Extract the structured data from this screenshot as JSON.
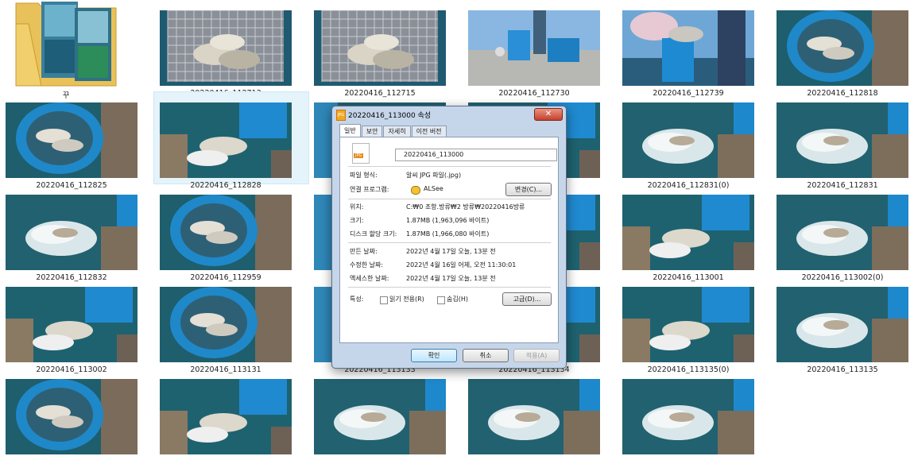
{
  "folder": {
    "label": "꾸"
  },
  "tiles": [
    {
      "id": "t01",
      "label": "20220416_112713",
      "col": 1,
      "row": 0,
      "scene": "net"
    },
    {
      "id": "t02",
      "label": "20220416_112715",
      "col": 2,
      "row": 0,
      "scene": "net"
    },
    {
      "id": "t03",
      "label": "20220416_112730",
      "col": 3,
      "row": 0,
      "scene": "boat"
    },
    {
      "id": "t04",
      "label": "20220416_112739",
      "col": 4,
      "row": 0,
      "scene": "person"
    },
    {
      "id": "t05",
      "label": "20220416_112818",
      "col": 5,
      "row": 0,
      "scene": "bucket"
    },
    {
      "id": "t06",
      "label": "20220416_112825",
      "col": 0,
      "row": 1,
      "scene": "bucket"
    },
    {
      "id": "t07",
      "label": "20220416_112828",
      "col": 1,
      "row": 1,
      "scene": "pour",
      "selected": true
    },
    {
      "id": "t08",
      "label": "",
      "col": 2,
      "row": 1,
      "scene": "water"
    },
    {
      "id": "t09",
      "label": "",
      "col": 3,
      "row": 1,
      "scene": "pour"
    },
    {
      "id": "t10",
      "label": "20220416_112831(0)",
      "col": 4,
      "row": 1,
      "scene": "splash"
    },
    {
      "id": "t11",
      "label": "20220416_112831",
      "col": 5,
      "row": 1,
      "scene": "splash"
    },
    {
      "id": "t12",
      "label": "20220416_112832",
      "col": 0,
      "row": 2,
      "scene": "splash"
    },
    {
      "id": "t13",
      "label": "20220416_112959",
      "col": 1,
      "row": 2,
      "scene": "bucket"
    },
    {
      "id": "t14",
      "label": "",
      "col": 2,
      "row": 2,
      "scene": "water"
    },
    {
      "id": "t15",
      "label": "",
      "col": 3,
      "row": 2,
      "scene": "pour"
    },
    {
      "id": "t16",
      "label": "20220416_113001",
      "col": 4,
      "row": 2,
      "scene": "pour"
    },
    {
      "id": "t17",
      "label": "20220416_113002(0)",
      "col": 5,
      "row": 2,
      "scene": "splash"
    },
    {
      "id": "t18",
      "label": "20220416_113002",
      "col": 0,
      "row": 3,
      "scene": "pour"
    },
    {
      "id": "t19",
      "label": "20220416_113131",
      "col": 1,
      "row": 3,
      "scene": "bucket"
    },
    {
      "id": "t20",
      "label": "20220416_113133",
      "col": 2,
      "row": 3,
      "scene": "water"
    },
    {
      "id": "t21",
      "label": "20220416_113134",
      "col": 3,
      "row": 3,
      "scene": "pour"
    },
    {
      "id": "t22",
      "label": "20220416_113135(0)",
      "col": 4,
      "row": 3,
      "scene": "pour"
    },
    {
      "id": "t23",
      "label": "20220416_113135",
      "col": 5,
      "row": 3,
      "scene": "splash"
    },
    {
      "id": "t24",
      "label": "",
      "col": 0,
      "row": 4,
      "scene": "bucket"
    },
    {
      "id": "t25",
      "label": "",
      "col": 1,
      "row": 4,
      "scene": "pour"
    },
    {
      "id": "t26",
      "label": "",
      "col": 2,
      "row": 4,
      "scene": "splash"
    },
    {
      "id": "t27",
      "label": "",
      "col": 3,
      "row": 4,
      "scene": "splash"
    },
    {
      "id": "t28",
      "label": "",
      "col": 4,
      "row": 4,
      "scene": "splash"
    }
  ],
  "dialog": {
    "title": "20220416_113000 속성",
    "close": "✕",
    "tabs": [
      "일반",
      "보안",
      "자세히",
      "이전 버전"
    ],
    "filename": "20220416_113000",
    "file_icon_text": "JPG",
    "props": {
      "type_label": "파일 형식:",
      "type_value": "알씨 JPG 파일(.jpg)",
      "open_label": "연결 프로그램:",
      "open_value": "ALSee",
      "change_btn": "변경(C)...",
      "location_label": "위치:",
      "location_value": "C:₩0 조항.방류₩2 방류₩20220416방류",
      "size_label": "크기:",
      "size_value": "1.87MB (1,963,096 바이트)",
      "disk_label": "디스크 할당 크기:",
      "disk_value": "1.87MB (1,966,080 바이트)",
      "created_label": "만든 날짜:",
      "created_value": "2022년 4월 17일 오늘, 13분 전",
      "modified_label": "수정한 날짜:",
      "modified_value": "2022년 4월 16일 어제, 오전 11:30:01",
      "accessed_label": "액세스한 날짜:",
      "accessed_value": "2022년 4월 17일 오늘, 13분 전",
      "attr_label": "특성:",
      "readonly": "읽기 전용(R)",
      "hidden": "숨김(H)",
      "advanced_btn": "고급(D)..."
    },
    "buttons": {
      "ok": "확인",
      "cancel": "취소",
      "apply": "적용(A)"
    }
  }
}
